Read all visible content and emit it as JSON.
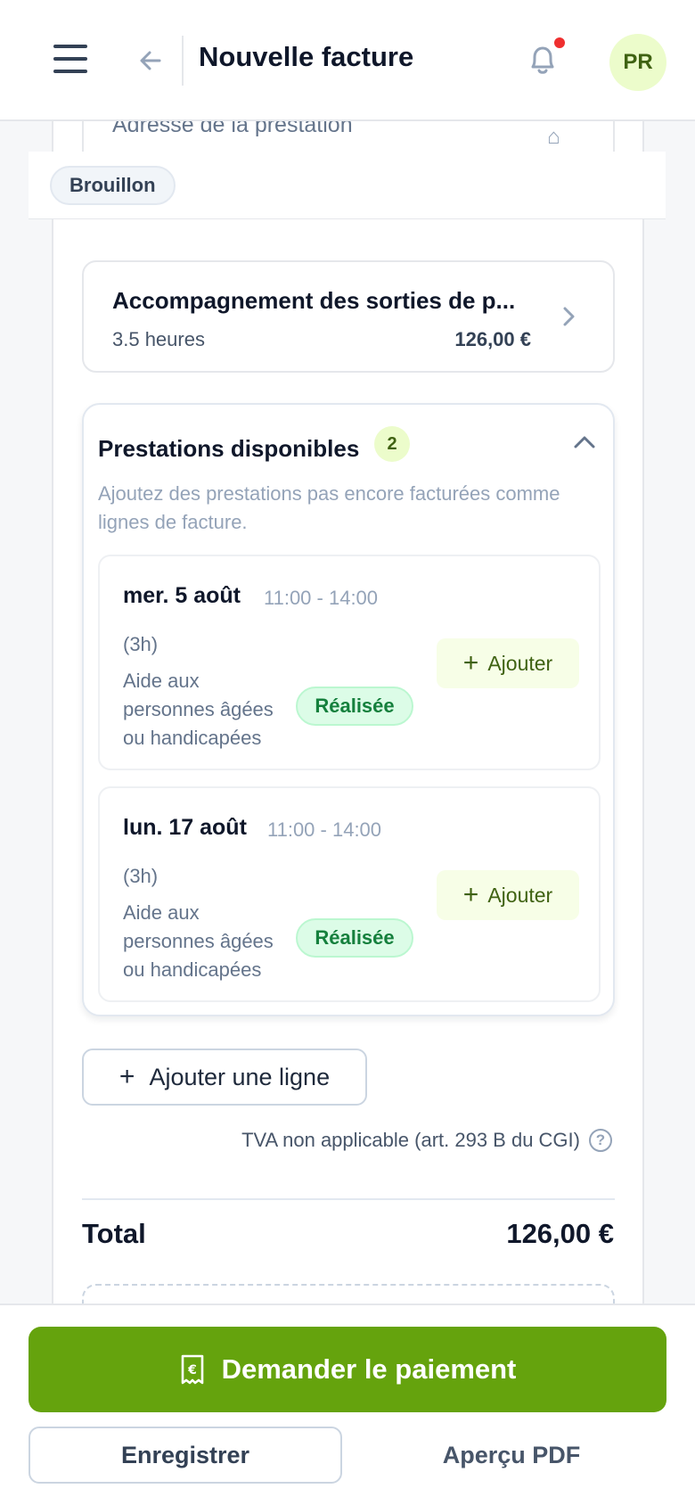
{
  "header": {
    "title": "Nouvelle facture",
    "avatar_initials": "PR"
  },
  "address_field": {
    "label": "Adresse de la prestation"
  },
  "status": {
    "label": "Brouillon"
  },
  "line_item": {
    "title": "Accompagnement des sorties de p...",
    "quantity": "3.5 heures",
    "amount": "126,00 €"
  },
  "available": {
    "title": "Prestations disponibles",
    "count": "2",
    "description": "Ajoutez des prestations pas encore facturées comme lignes de facture.",
    "items": [
      {
        "date": "mer. 5 août",
        "time": "11:00 - 14:00",
        "duration": "(3h)",
        "type": "Aide aux personnes âgées ou handicapées",
        "status": "Réalisée",
        "add_label": "Ajouter"
      },
      {
        "date": "lun. 17 août",
        "time": "11:00 - 14:00",
        "duration": "(3h)",
        "type": "Aide aux personnes âgées ou handicapées",
        "status": "Réalisée",
        "add_label": "Ajouter"
      }
    ]
  },
  "add_line_label": "Ajouter une ligne",
  "tva_note": "TVA non applicable (art. 293 B du CGI)",
  "total": {
    "label": "Total",
    "value": "126,00 €"
  },
  "actions": {
    "pay_label": "Demander le paiement",
    "save_label": "Enregistrer",
    "pdf_label": "Aperçu PDF"
  },
  "colors": {
    "primary": "#65a30d",
    "badge_green": "#15803d",
    "notification": "#ef2f2f"
  }
}
